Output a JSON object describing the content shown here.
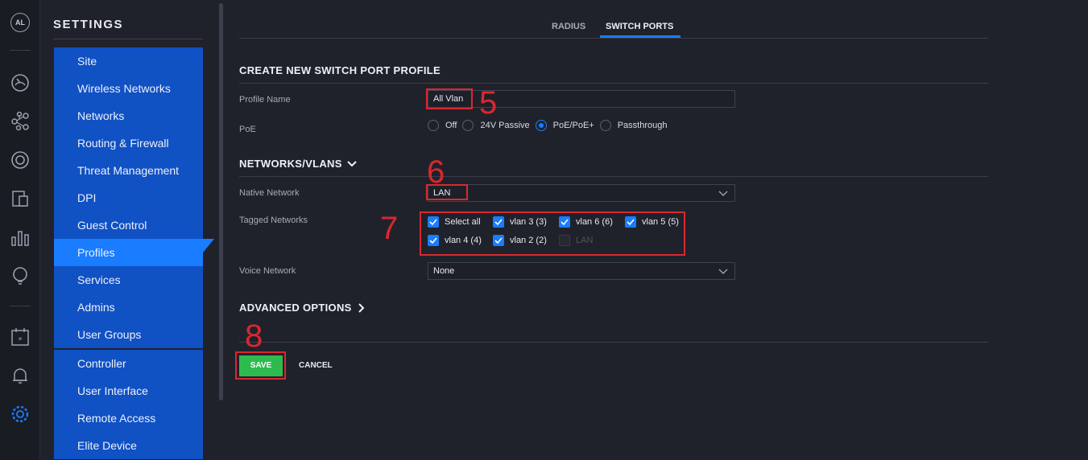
{
  "app": {
    "avatar_initials": "AL",
    "accent_color": "#1a7cff",
    "save_color": "#2dbb4f",
    "annotation_color": "#d9282f"
  },
  "rail_icons": [
    "dashboard-icon",
    "topology-icon",
    "devices-icon",
    "clients-icon",
    "statistics-icon",
    "insights-icon",
    "events-icon",
    "alerts-icon",
    "settings-icon"
  ],
  "settings": {
    "title": "SETTINGS",
    "menu_group1": [
      "Site",
      "Wireless Networks",
      "Networks",
      "Routing & Firewall",
      "Threat Management",
      "DPI",
      "Guest Control",
      "Profiles",
      "Services",
      "Admins",
      "User Groups"
    ],
    "active_item": "Profiles",
    "menu_group2": [
      "Controller",
      "User Interface",
      "Remote Access",
      "Elite Device"
    ]
  },
  "tabs": [
    {
      "label": "RADIUS",
      "active": false
    },
    {
      "label": "SWITCH PORTS",
      "active": true
    }
  ],
  "form": {
    "create_title": "CREATE NEW SWITCH PORT PROFILE",
    "profile_name_label": "Profile Name",
    "profile_name_value": "All Vlan",
    "poe_label": "PoE",
    "poe_options": [
      {
        "label": "Off",
        "checked": false
      },
      {
        "label": "24V Passive",
        "checked": false
      },
      {
        "label": "PoE/PoE+",
        "checked": true
      },
      {
        "label": "Passthrough",
        "checked": false
      }
    ],
    "networks_title": "NETWORKS/VLANS",
    "native_label": "Native Network",
    "native_value": "LAN",
    "tagged_label": "Tagged Networks",
    "tagged": [
      {
        "label": "Select all",
        "checked": true
      },
      {
        "label": "vlan 3 (3)",
        "checked": true
      },
      {
        "label": "vlan 6 (6)",
        "checked": true
      },
      {
        "label": "vlan 5 (5)",
        "checked": true
      },
      {
        "label": "vlan 4 (4)",
        "checked": true
      },
      {
        "label": "vlan 2 (2)",
        "checked": true
      },
      {
        "label": "LAN",
        "checked": false,
        "disabled": true
      }
    ],
    "voice_label": "Voice Network",
    "voice_value": "None",
    "advanced_title": "ADVANCED OPTIONS",
    "save_label": "SAVE",
    "cancel_label": "CANCEL"
  },
  "annotations": {
    "n5": "5",
    "n6": "6",
    "n7": "7",
    "n8": "8"
  }
}
